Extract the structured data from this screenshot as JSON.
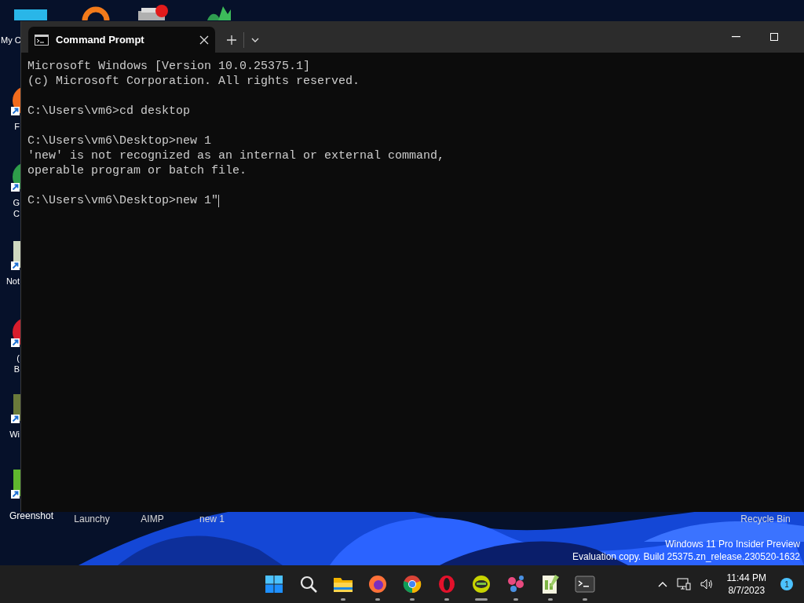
{
  "desktop": {
    "icons_left": [
      {
        "label": "My C",
        "kind": "monitor"
      },
      {
        "label": "F",
        "kind": "orange"
      },
      {
        "label": "G\nC",
        "kind": "green"
      },
      {
        "label": "Not",
        "kind": "notepad"
      },
      {
        "label": "(\nB",
        "kind": "red"
      },
      {
        "label": "Wi",
        "kind": "archive"
      },
      {
        "label": "Greenshot",
        "kind": "greenshot"
      }
    ],
    "icons_bottom": [
      "Launchy",
      "AIMP",
      "new 1",
      "Recycle Bin"
    ],
    "watermark": [
      "Windows 11 Pro Insider Preview",
      "Evaluation copy. Build 25375.zn_release.230520-1632"
    ]
  },
  "window": {
    "tab": {
      "title": "Command Prompt",
      "selected": true
    },
    "paragraphs": [
      [
        "Microsoft Windows [Version 10.0.25375.1]",
        "(c) Microsoft Corporation. All rights reserved."
      ],
      [
        "C:\\Users\\vm6>cd desktop"
      ],
      [
        "C:\\Users\\vm6\\Desktop>new 1",
        "'new' is not recognized as an internal or external command,",
        "operable program or batch file."
      ],
      [
        "C:\\Users\\vm6\\Desktop>new 1\""
      ]
    ]
  },
  "taskbar": {
    "apps": [
      {
        "kind": "start",
        "running": false
      },
      {
        "kind": "search",
        "running": false
      },
      {
        "kind": "folder",
        "running": true
      },
      {
        "kind": "firefox",
        "running": true
      },
      {
        "kind": "chrome",
        "running": true
      },
      {
        "kind": "opera",
        "running": true
      },
      {
        "kind": "greenapp",
        "running": true
      },
      {
        "kind": "molecule",
        "running": true
      },
      {
        "kind": "notepad",
        "running": true
      },
      {
        "kind": "terminal",
        "running": true
      }
    ],
    "time": "11:44 PM",
    "date": "8/7/2023",
    "notifications": "1"
  }
}
